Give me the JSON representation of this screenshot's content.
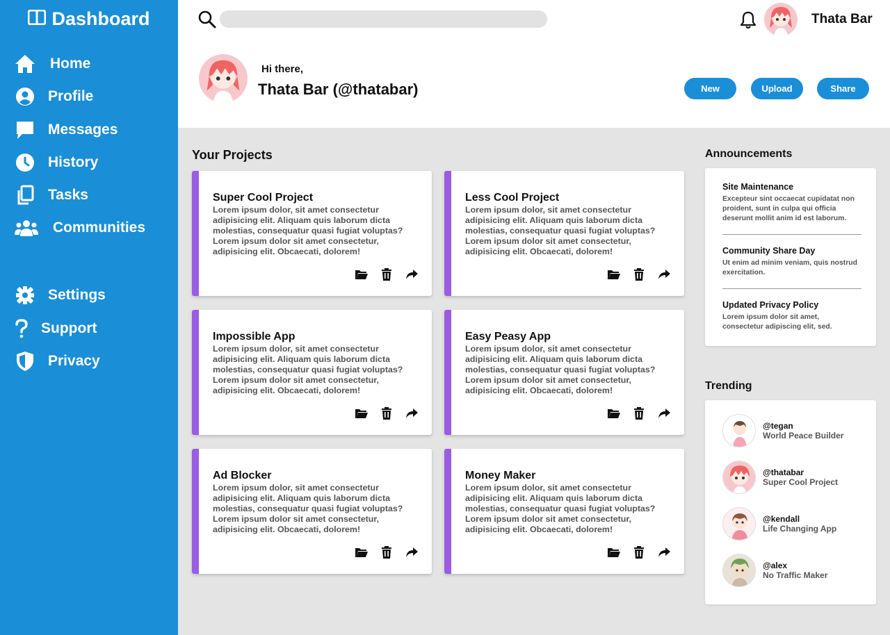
{
  "brand": {
    "title": "Dashboard"
  },
  "sidebar": {
    "items": [
      {
        "label": "Home",
        "icon": "home-icon"
      },
      {
        "label": "Profile",
        "icon": "profile-icon"
      },
      {
        "label": "Messages",
        "icon": "messages-icon"
      },
      {
        "label": "History",
        "icon": "history-icon"
      },
      {
        "label": "Tasks",
        "icon": "tasks-icon"
      },
      {
        "label": "Communities",
        "icon": "communities-icon"
      }
    ],
    "bottom_items": [
      {
        "label": "Settings",
        "icon": "gear-icon"
      },
      {
        "label": "Support",
        "icon": "question-icon"
      },
      {
        "label": "Privacy",
        "icon": "shield-icon"
      }
    ]
  },
  "topbar": {
    "search_placeholder": "",
    "user_name": "Thata Bar"
  },
  "header": {
    "greeting": "Hi there,",
    "full_name": "Thata Bar (@thatabar)",
    "buttons": {
      "new": "New",
      "upload": "Upload",
      "share": "Share"
    }
  },
  "projects": {
    "title": "Your Projects",
    "items": [
      {
        "title": "Super Cool Project",
        "description": "Lorem ipsum dolor, sit amet consectetur adipisicing elit. Aliquam quis laborum dicta molestias, consequatur quasi fugiat voluptas? Lorem ipsum dolor sit amet consectetur, adipisicing elit. Obcaecati, dolorem!"
      },
      {
        "title": "Less Cool Project",
        "description": "Lorem ipsum dolor, sit amet consectetur adipisicing elit. Aliquam quis laborum dicta molestias, consequatur quasi fugiat voluptas? Lorem ipsum dolor sit amet consectetur, adipisicing elit. Obcaecati, dolorem!"
      },
      {
        "title": "Impossible App",
        "description": "Lorem ipsum dolor, sit amet consectetur adipisicing elit. Aliquam quis laborum dicta molestias, consequatur quasi fugiat voluptas? Lorem ipsum dolor sit amet consectetur, adipisicing elit. Obcaecati, dolorem!"
      },
      {
        "title": "Easy Peasy App",
        "description": "Lorem ipsum dolor, sit amet consectetur adipisicing elit. Aliquam quis laborum dicta molestias, consequatur quasi fugiat voluptas? Lorem ipsum dolor sit amet consectetur, adipisicing elit. Obcaecati, dolorem!"
      },
      {
        "title": "Ad Blocker",
        "description": "Lorem ipsum dolor, sit amet consectetur adipisicing elit. Aliquam quis laborum dicta molestias, consequatur quasi fugiat voluptas? Lorem ipsum dolor sit amet consectetur, adipisicing elit. Obcaecati, dolorem!"
      },
      {
        "title": "Money Maker",
        "description": "Lorem ipsum dolor, sit amet consectetur adipisicing elit. Aliquam quis laborum dicta molestias, consequatur quasi fugiat voluptas? Lorem ipsum dolor sit amet consectetur, adipisicing elit. Obcaecati, dolorem!"
      }
    ]
  },
  "announcements": {
    "title": "Announcements",
    "items": [
      {
        "title": "Site Maintenance",
        "body": "Excepteur sint occaecat cupidatat non proident, sunt in culpa qui officia deserunt mollit anim id est laborum."
      },
      {
        "title": "Community Share Day",
        "body": "Ut enim ad minim veniam, quis nostrud exercitation."
      },
      {
        "title": "Updated Privacy Policy",
        "body": "Lorem ipsum dolor sit amet, consectetur adipiscing elit, sed."
      }
    ]
  },
  "trending": {
    "title": "Trending",
    "items": [
      {
        "handle": "@tegan",
        "project": "World Peace Builder"
      },
      {
        "handle": "@thatabar",
        "project": "Super Cool Project"
      },
      {
        "handle": "@kendall",
        "project": "Life Changing App"
      },
      {
        "handle": "@alex",
        "project": "No Traffic Maker"
      }
    ]
  },
  "colors": {
    "sidebar_bg": "#1a8ed6",
    "accent_purple": "#9a5ce3",
    "button_blue": "#1a8ed6",
    "page_bg": "#e4e4e4"
  }
}
